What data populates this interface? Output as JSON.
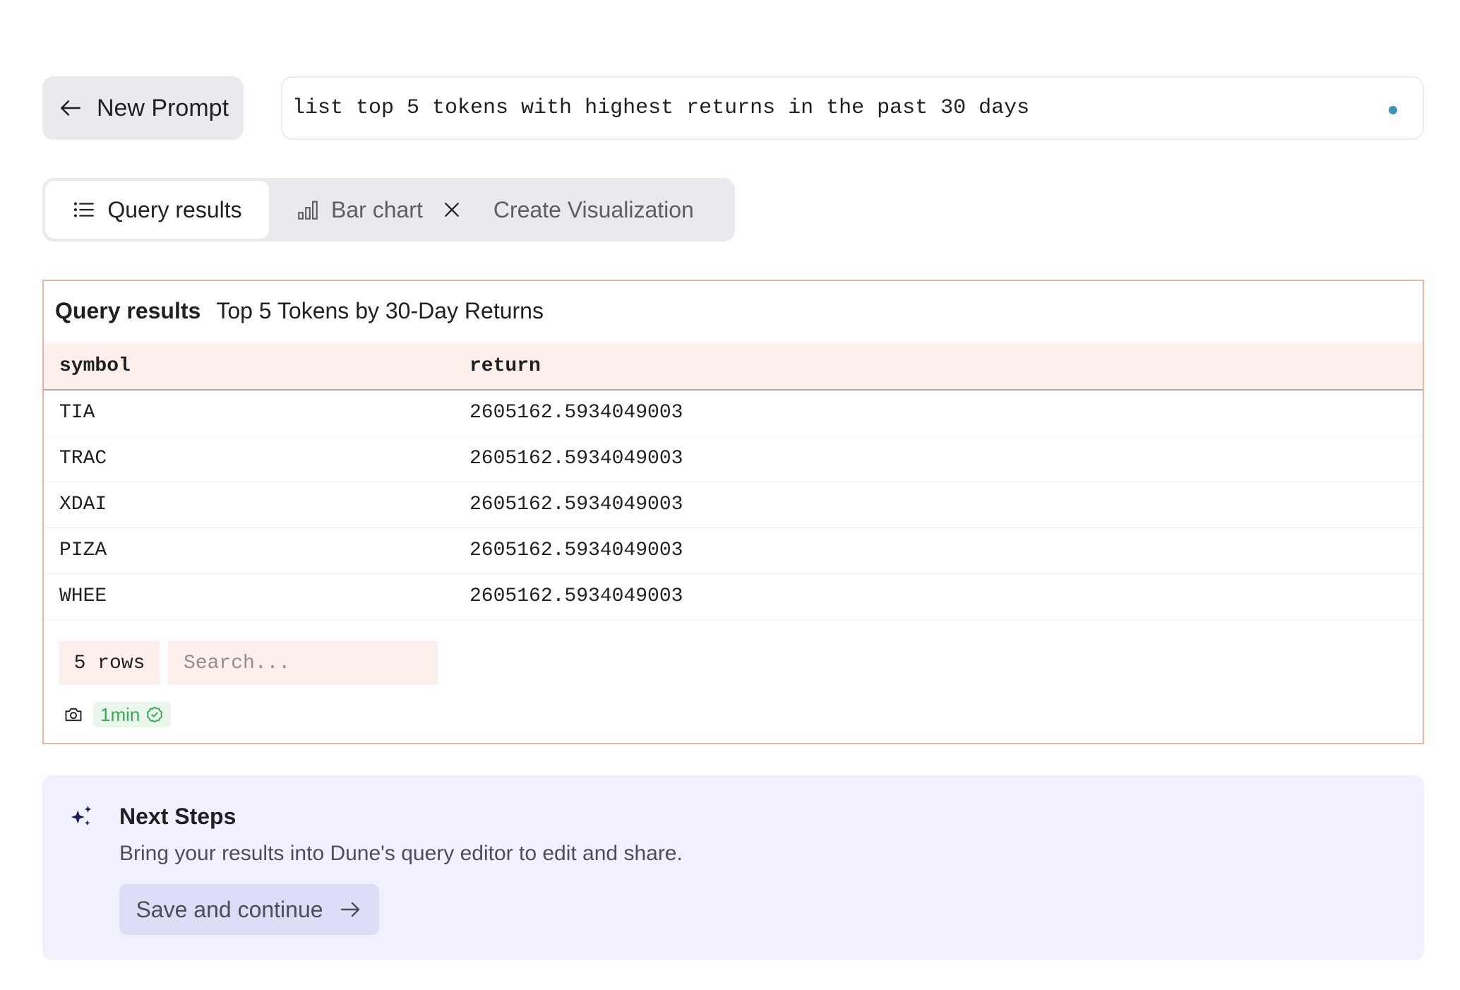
{
  "prompt": {
    "new_prompt_label": "New Prompt",
    "query_text": "list top 5 tokens with highest returns in the past 30 days"
  },
  "tabs": {
    "query_results_label": "Query results",
    "bar_chart_label": "Bar chart",
    "create_visualization_label": "Create Visualization"
  },
  "results": {
    "label": "Query results",
    "title": "Top 5 Tokens by 30-Day Returns",
    "columns": [
      "symbol",
      "return"
    ],
    "rows": [
      [
        "TIA",
        "2605162.5934049003"
      ],
      [
        "TRAC",
        "2605162.5934049003"
      ],
      [
        "XDAI",
        "2605162.5934049003"
      ],
      [
        "PIZA",
        "2605162.5934049003"
      ],
      [
        "WHEE",
        "2605162.5934049003"
      ]
    ],
    "row_count_label": "5 rows",
    "search_placeholder": "Search...",
    "freshness": "1min"
  },
  "next_steps": {
    "title": "Next Steps",
    "description": "Bring your results into Dune's query editor to edit and share.",
    "save_label": "Save and continue"
  },
  "icons": {
    "back": "arrow-left-icon",
    "list": "list-icon",
    "bar_chart": "bar-chart-icon",
    "close": "close-icon",
    "camera": "camera-icon",
    "check": "check-circle-icon",
    "sparkle": "sparkle-icon",
    "forward": "arrow-right-icon"
  },
  "colors": {
    "accent_border": "#f0b4a3",
    "header_bg": "#fcefec",
    "next_steps_bg": "#f0f1fd",
    "success": "#3aa85a",
    "status_dot": "#3b93b5"
  }
}
